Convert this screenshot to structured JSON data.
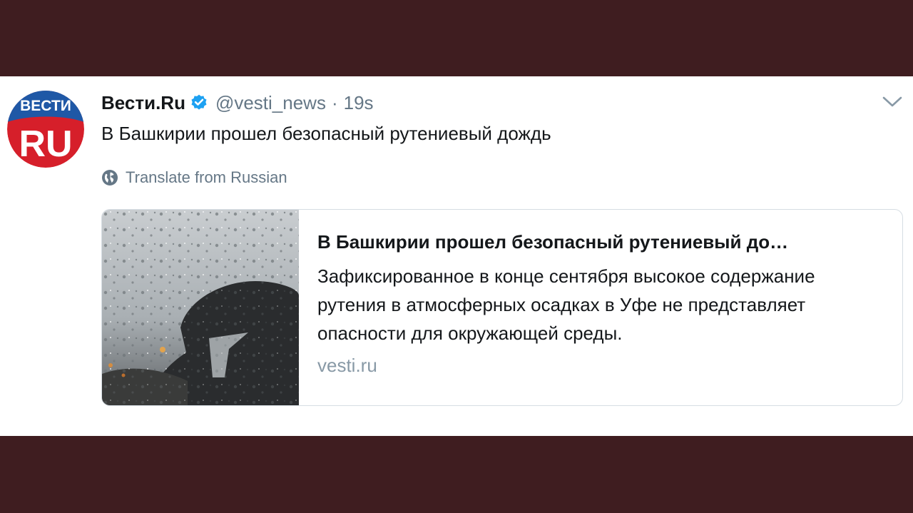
{
  "tweet": {
    "display_name": "Вести.Ru",
    "handle": "@vesti_news",
    "separator": "·",
    "timestamp": "19s",
    "verified": true,
    "text": "В Башкирии прошел безопасный рутениевый дождь",
    "translate_label": "Translate from Russian",
    "avatar": {
      "logo_top": "ВЕСТИ",
      "logo_bottom": "RU"
    },
    "icons": {
      "verified": "verified-badge-icon",
      "menu": "chevron-down-icon",
      "translate": "globe-icon"
    }
  },
  "card": {
    "title": "В Башкирии прошел безопасный рутениевый до…",
    "description": "Зафиксированное в конце сентября высокое содержание рутения в атмосферных осадках в Уфе не представляет опасности для окружающей среды.",
    "domain": "vesti.ru",
    "image": "rainy-window-umbrella-photo"
  },
  "colors": {
    "background": "#3f1d20",
    "verified": "#1da1f2",
    "secondary_text": "#657786",
    "logo_blue": "#1f58a6",
    "logo_red": "#d61f2a"
  }
}
